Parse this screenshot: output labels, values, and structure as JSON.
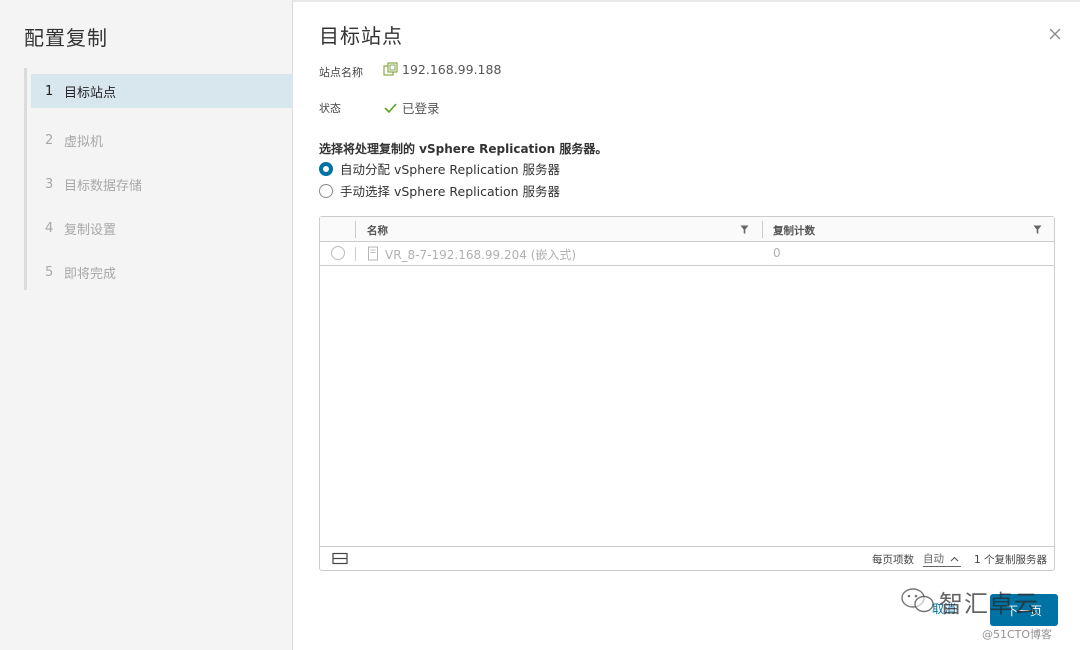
{
  "wizard": {
    "title": "配置复制",
    "steps": [
      {
        "num": "1",
        "label": "目标站点"
      },
      {
        "num": "2",
        "label": "虚拟机"
      },
      {
        "num": "3",
        "label": "目标数据存储"
      },
      {
        "num": "4",
        "label": "复制设置"
      },
      {
        "num": "5",
        "label": "即将完成"
      }
    ],
    "active_step": 0
  },
  "page": {
    "title": "目标站点",
    "site_name_label": "站点名称",
    "site_name_value": "192.168.99.188",
    "status_label": "状态",
    "status_value": "已登录",
    "section_heading": "选择将处理复制的 vSphere Replication 服务器。",
    "option_auto": "自动分配 vSphere Replication 服务器",
    "option_manual": "手动选择 vSphere Replication 服务器",
    "selected_option": "auto"
  },
  "grid": {
    "columns": [
      "名称",
      "复制计数"
    ],
    "rows": [
      {
        "name": "VR_8-7-192.168.99.204 (嵌入式)",
        "count": "0"
      }
    ],
    "footer": {
      "per_page_label": "每页项数",
      "per_page_value": "自动",
      "total": "1 个复制服务器"
    }
  },
  "buttons": {
    "cancel": "取消",
    "next": "下一页"
  },
  "watermark": {
    "brand": "智汇卓云",
    "site": "@51CTO博客"
  },
  "colors": {
    "accent": "#0072a3",
    "active_step_bg": "#d8e6ee",
    "success": "#5aa220"
  }
}
